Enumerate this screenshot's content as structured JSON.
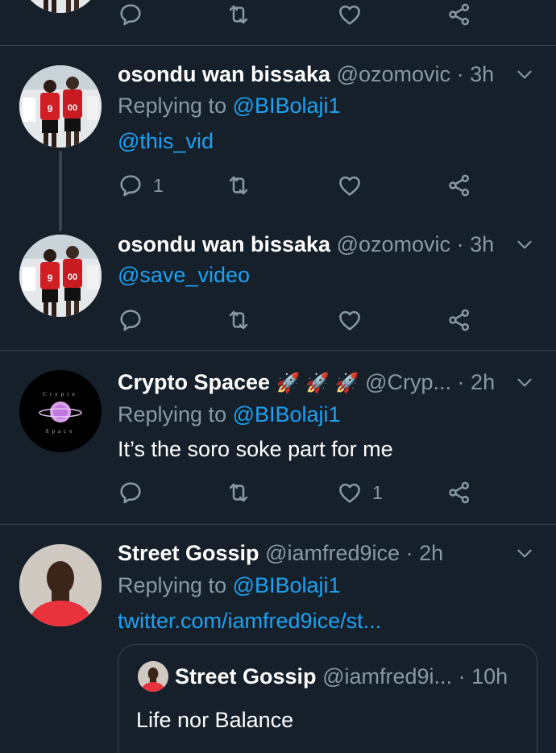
{
  "colors": {
    "background": "#15202b",
    "divider": "#38444d",
    "muted": "#8899a6",
    "accent": "#1da1f2",
    "text": "#ffffff"
  },
  "top_actions": {
    "icons": [
      "reply-icon",
      "retweet-icon",
      "like-icon",
      "share-icon"
    ]
  },
  "tweets": [
    {
      "name": "osondu wan bissaka",
      "handle": "@ozomovic",
      "dot": "·",
      "time": "3h",
      "replying_prefix": "Replying to ",
      "replying_to": "@BIBolaji1",
      "link": "@this_vid",
      "actions": {
        "reply_count": "1",
        "retweet_count": "",
        "like_count": ""
      }
    },
    {
      "name": "osondu wan bissaka",
      "handle": "@ozomovic",
      "dot": "·",
      "time": "3h",
      "link": "@save_video",
      "actions": {
        "reply_count": "",
        "retweet_count": "",
        "like_count": ""
      }
    },
    {
      "name": "Crypto Spacee",
      "emoji": "🚀 🚀 🚀",
      "handle": "@Cryp...",
      "dot": "·",
      "time": "2h",
      "avatar_text_top": "Crypto",
      "avatar_text_bottom": "Space",
      "replying_prefix": "Replying to ",
      "replying_to": "@BIBolaji1",
      "text": "It’s the soro soke part for me",
      "actions": {
        "reply_count": "",
        "retweet_count": "",
        "like_count": "1"
      }
    },
    {
      "name": "Street Gossip",
      "handle": "@iamfred9ice",
      "dot": "·",
      "time": "2h",
      "replying_prefix": "Replying to ",
      "replying_to": "@BIBolaji1",
      "link": "twitter.com/iamfred9ice/st...",
      "quote": {
        "name": "Street Gossip",
        "handle": "@iamfred9i...",
        "dot": "·",
        "time": "10h",
        "text": "Life nor Balance"
      }
    }
  ]
}
